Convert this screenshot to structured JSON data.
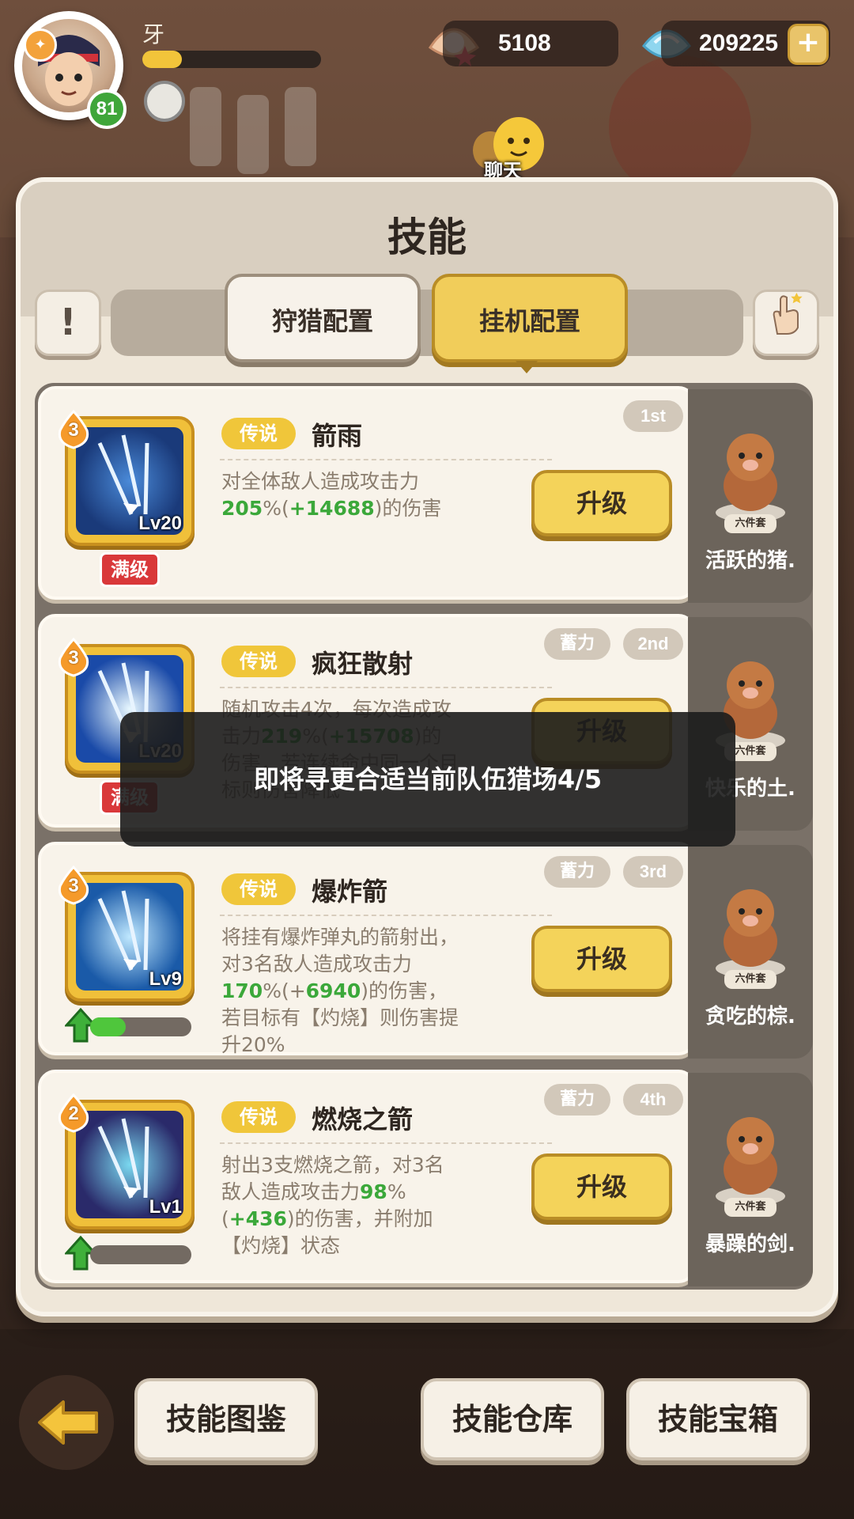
{
  "player": {
    "name": "牙",
    "level": "81",
    "exp_fraction": 0.22
  },
  "currency": {
    "pearls": "5108",
    "gems": "209225"
  },
  "chat": {
    "label": "聊天"
  },
  "panel": {
    "title": "技能"
  },
  "tabs": {
    "hunt": "狩猎配置",
    "idle": "挂机配置",
    "active": "idle"
  },
  "skills": [
    {
      "star": "3",
      "icon_level": "Lv20",
      "rarity": "传说",
      "name": "箭雨",
      "order": "1st",
      "charge": "",
      "desc_parts": [
        "对全体敌人造成攻击力",
        "205",
        "%(",
        "+14688",
        ")的伤害"
      ],
      "max_label": "满级",
      "progress": null,
      "upgrade": "升级",
      "pet": {
        "set": "六件套",
        "name": "活跃的猪."
      }
    },
    {
      "star": "3",
      "icon_level": "Lv20",
      "rarity": "传说",
      "name": "疯狂散射",
      "order": "2nd",
      "charge": "蓄力",
      "desc_parts": [
        "随机攻击4次，每次造成攻击力",
        "219",
        "%(",
        "+15708",
        ")的伤害，若连续命中同一个目标则伤害降低"
      ],
      "max_label": "满级",
      "progress": null,
      "upgrade": "升级",
      "pet": {
        "set": "六件套",
        "name": "快乐的土."
      }
    },
    {
      "star": "3",
      "icon_level": "Lv9",
      "rarity": "传说",
      "name": "爆炸箭",
      "order": "3rd",
      "charge": "蓄力",
      "desc_parts": [
        "将挂有爆炸弹丸的箭射出，对3名敌人造成攻击力",
        "170",
        "%(+",
        "6940",
        ")的伤害，若目标有【灼烧】则伤害提升20%"
      ],
      "max_label": "",
      "progress": 0.35,
      "upgrade": "升级",
      "pet": {
        "set": "六件套",
        "name": "贪吃的棕."
      }
    },
    {
      "star": "2",
      "icon_level": "Lv1",
      "rarity": "传说",
      "name": "燃烧之箭",
      "order": "4th",
      "charge": "蓄力",
      "desc_parts": [
        "射出3支燃烧之箭，对3名敌人造成攻击力",
        "98",
        "%(",
        "+436",
        ")的伤害，并附加【灼烧】状态"
      ],
      "max_label": "",
      "progress": 0.0,
      "upgrade": "升级",
      "pet": {
        "set": "六件套",
        "name": "暴躁的剑."
      }
    }
  ],
  "toast": "即将寻更合适当前队伍猎场4/5",
  "bottom_nav": {
    "atlas": "技能图鉴",
    "store": "技能仓库",
    "chest": "技能宝箱"
  }
}
